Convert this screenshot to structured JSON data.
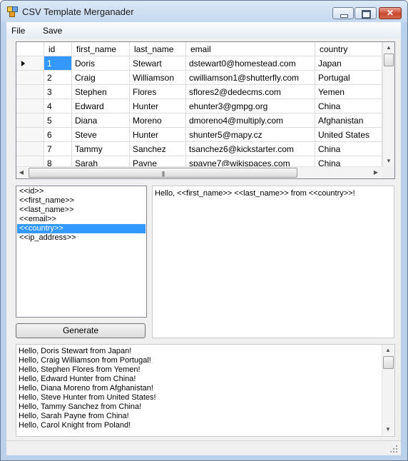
{
  "window": {
    "title": "CSV Template Merganader"
  },
  "menu": {
    "file": "File",
    "save": "Save"
  },
  "grid": {
    "columns": [
      "id",
      "first_name",
      "last_name",
      "email",
      "country"
    ],
    "rows": [
      [
        "1",
        "Doris",
        "Stewart",
        "dstewart0@homestead.com",
        "Japan"
      ],
      [
        "2",
        "Craig",
        "Williamson",
        "cwilliamson1@shutterfly.com",
        "Portugal"
      ],
      [
        "3",
        "Stephen",
        "Flores",
        "sflores2@dedecms.com",
        "Yemen"
      ],
      [
        "4",
        "Edward",
        "Hunter",
        "ehunter3@gmpg.org",
        "China"
      ],
      [
        "5",
        "Diana",
        "Moreno",
        "dmoreno4@multiply.com",
        "Afghanistan"
      ],
      [
        "6",
        "Steve",
        "Hunter",
        "shunter5@mapy.cz",
        "United States"
      ],
      [
        "7",
        "Tammy",
        "Sanchez",
        "tsanchez6@kickstarter.com",
        "China"
      ],
      [
        "8",
        "Sarah",
        "Payne",
        "spayne7@wikispaces.com",
        "China"
      ]
    ]
  },
  "placeholders": [
    "<<id>>",
    "<<first_name>>",
    "<<last_name>>",
    "<<email>>",
    "<<country>>",
    "<<ip_address>>"
  ],
  "selected_placeholder": "<<country>>",
  "template": {
    "text": "Hello, <<first_name>> <<last_name>> from <<country>>!"
  },
  "generate": {
    "label": "Generate"
  },
  "output": {
    "lines": [
      "Hello, Doris Stewart from Japan!",
      "Hello, Craig Williamson from Portugal!",
      "Hello, Stephen Flores from Yemen!",
      "Hello, Edward Hunter from China!",
      "Hello, Diana Moreno from Afghanistan!",
      "Hello, Steve Hunter from United States!",
      "Hello, Tammy Sanchez from China!",
      "Hello, Sarah Payne from China!",
      "Hello, Carol Knight from Poland!"
    ]
  },
  "icons": {
    "app": "csv-app-icon",
    "scroll_up": "scroll-up-icon",
    "scroll_down": "scroll-down-icon",
    "scroll_left": "scroll-left-icon",
    "scroll_right": "scroll-right-icon",
    "current_row": "current-row-arrow-icon",
    "size_grip": "size-grip-icon"
  },
  "colors": {
    "selection": "#3399ff",
    "window_frame": "#b9d1ea",
    "close_button": "#c9462c"
  }
}
